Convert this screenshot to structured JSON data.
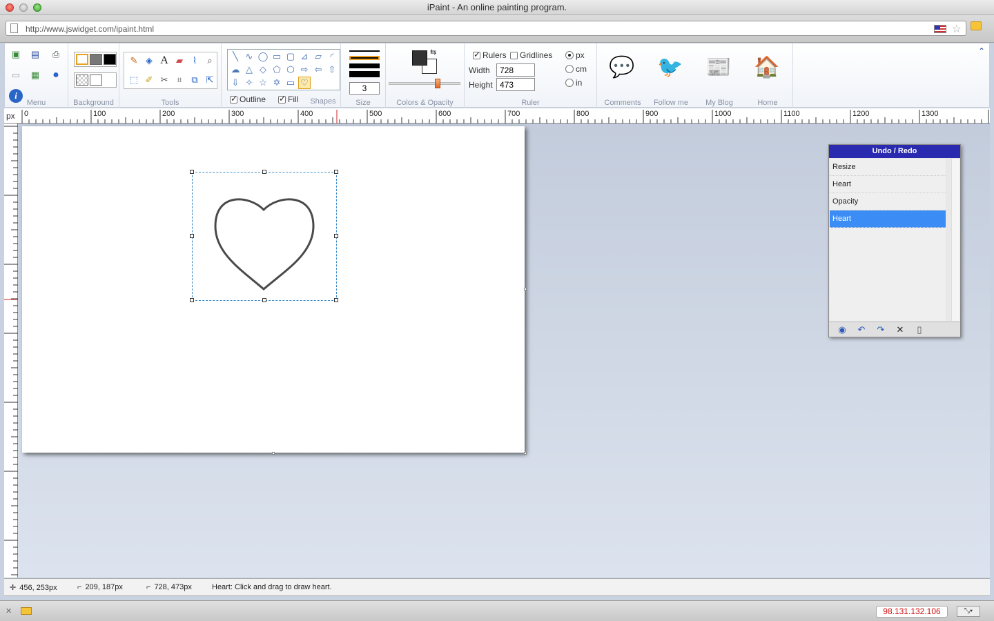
{
  "window": {
    "title": "iPaint - An online painting program."
  },
  "browser": {
    "url": "http://www.jswidget.com/ipaint.html",
    "ip": "98.131.132.106"
  },
  "toolbar": {
    "groups": {
      "menu": "Menu",
      "background": "Background",
      "tools": "Tools",
      "shapes": "Shapes",
      "size": "Size",
      "colors": "Colors & Opacity",
      "ruler": "Ruler"
    },
    "outline_label": "Outline",
    "fill_label": "Fill",
    "size_value": "3",
    "rulers_label": "Rulers",
    "gridlines_label": "Gridlines",
    "width_label": "Width",
    "width_value": "728",
    "height_label": "Height",
    "height_value": "473",
    "unit_px": "px",
    "unit_cm": "cm",
    "unit_in": "in",
    "social": {
      "comments": "Comments",
      "follow": "Follow me",
      "blog": "My Blog",
      "home": "Home"
    },
    "fg_color": "#333333",
    "bg_color": "#ffffff"
  },
  "ruler": {
    "unit": "px",
    "labels": [
      "0",
      "100",
      "200",
      "300",
      "400",
      "500",
      "600",
      "700",
      "800",
      "900",
      "1000",
      "1100",
      "1200",
      "1300"
    ]
  },
  "undo": {
    "title": "Undo / Redo",
    "items": [
      {
        "label": "Resize"
      },
      {
        "label": "Heart"
      },
      {
        "label": "Opacity"
      },
      {
        "label": "Heart"
      }
    ]
  },
  "status": {
    "cursor": "456, 253px",
    "selection_origin": "209, 187px",
    "canvas_size": "728, 473px",
    "hint": "Heart: Click and drag to draw heart."
  }
}
